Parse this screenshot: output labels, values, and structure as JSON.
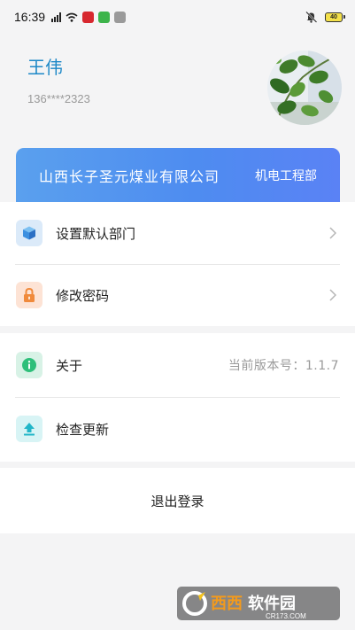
{
  "status_bar": {
    "time": "16:39",
    "battery": "40"
  },
  "profile": {
    "name": "王伟",
    "phone": "136****2323"
  },
  "company": {
    "name": "山西长子圣元煤业有限公司",
    "department": "机电工程部"
  },
  "menu": {
    "set_default_dept": "设置默认部门",
    "change_password": "修改密码",
    "about": "关于",
    "version": "当前版本号：1.1.7",
    "check_update": "检查更新"
  },
  "logout": "退出登录",
  "watermark": {
    "brand": "西西软件园",
    "url": "CR173.COM"
  },
  "colors": {
    "name_blue": "#1d88c7",
    "card_gradient_start": "#5aa0ee",
    "card_gradient_end": "#5a82f5",
    "icon_dept_bg": "#dbeaf9",
    "icon_lock_bg": "#fde3d5",
    "icon_info_bg": "#d8f2e6",
    "icon_update_bg": "#d8f4f5"
  },
  "icons": {
    "dept": "cube-icon",
    "password": "lock-icon",
    "about": "info-icon",
    "update": "upload-arrow-icon",
    "chevron": "chevron-right-icon"
  }
}
